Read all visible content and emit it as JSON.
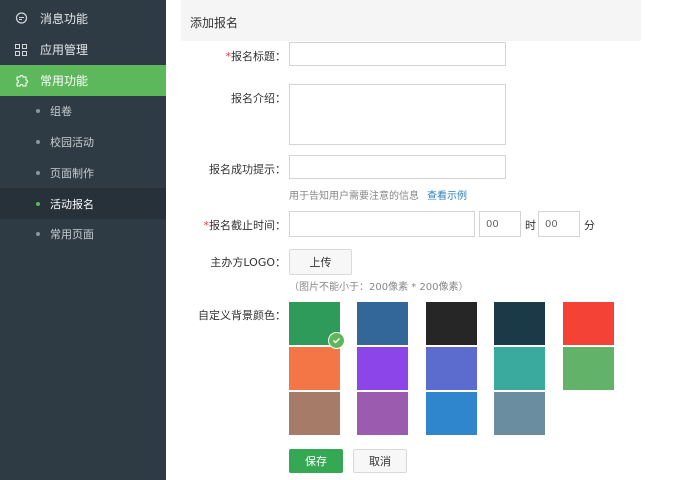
{
  "sidebar": {
    "top_items": [
      {
        "label": "消息功能",
        "icon": "chat-icon"
      },
      {
        "label": "应用管理",
        "icon": "grid-icon"
      },
      {
        "label": "常用功能",
        "icon": "puzzle-icon",
        "active": true
      }
    ],
    "sub_items": [
      {
        "label": "组卷"
      },
      {
        "label": "校园活动"
      },
      {
        "label": "页面制作"
      },
      {
        "label": "活动报名",
        "active": true
      },
      {
        "label": "常用页面"
      }
    ]
  },
  "header": {
    "title": "添加报名"
  },
  "form": {
    "title_label": "报名标题：",
    "intro_label": "报名介绍：",
    "success_label": "报名成功提示：",
    "success_hint": "用于告知用户需要注意的信息",
    "success_link": "查看示例",
    "deadline_label": "报名截止时间：",
    "deadline_hour": "00",
    "hour_unit": "时",
    "deadline_minute": "00",
    "minute_unit": "分",
    "required_mark": "*",
    "logo_label": "主办方LOGO：",
    "upload_button": "上传",
    "logo_hint": "（图片不能小于：200像素 * 200像素）",
    "bg_color_label": "自定义背景颜色："
  },
  "colors": [
    "#2e9b5b",
    "#336699",
    "#262626",
    "#1b3a47",
    "#f44336",
    "#f47646",
    "#8b45e8",
    "#5b6bce",
    "#3aa99e",
    "#63b26a",
    "#a67b68",
    "#9b5cb0",
    "#2f86cc",
    "#6a8ea0"
  ],
  "selected_color_index": 0,
  "actions": {
    "save": "保存",
    "cancel": "取消"
  },
  "accent": "#5db85b"
}
